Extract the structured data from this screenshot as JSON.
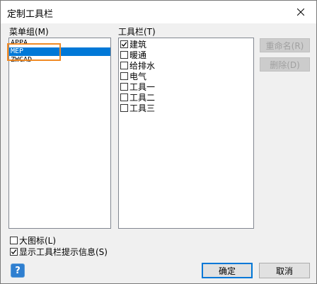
{
  "window": {
    "title": "定制工具栏",
    "close_icon": "close-icon"
  },
  "menu_group": {
    "label": "菜单组(M)",
    "items": [
      {
        "label": "APPA",
        "selected": false
      },
      {
        "label": "MEP",
        "selected": true
      },
      {
        "label": "ZWCAD",
        "selected": false
      }
    ]
  },
  "toolbar_list": {
    "label": "工具栏(T)",
    "items": [
      {
        "label": "建筑",
        "checked": true
      },
      {
        "label": "暖通",
        "checked": false
      },
      {
        "label": "给排水",
        "checked": false
      },
      {
        "label": "电气",
        "checked": false
      },
      {
        "label": "工具一",
        "checked": false
      },
      {
        "label": "工具二",
        "checked": false
      },
      {
        "label": "工具三",
        "checked": false
      }
    ]
  },
  "buttons": {
    "rename": "重命名(R)",
    "delete": "删除(D)",
    "ok": "确定",
    "cancel": "取消"
  },
  "options": {
    "large_icons": {
      "label": "大图标(L)",
      "checked": false
    },
    "show_tooltips": {
      "label": "显示工具栏提示信息(S)",
      "checked": true
    }
  },
  "help": {
    "icon": "help-icon",
    "glyph": "?"
  },
  "colors": {
    "selection": "#0078d7",
    "highlight_box": "#f08a24"
  }
}
